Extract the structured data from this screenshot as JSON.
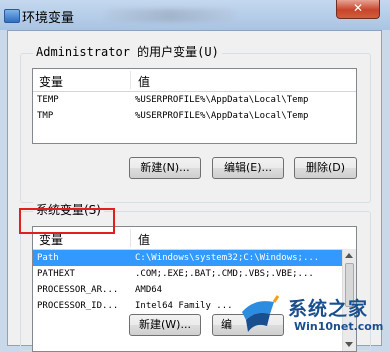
{
  "window": {
    "title": "环境变量",
    "close_label": "✕"
  },
  "user_vars": {
    "title": "Administrator 的用户变量(U)",
    "col_variable": "变量",
    "col_value": "值",
    "rows": [
      {
        "name": "TEMP",
        "value": "%USERPROFILE%\\AppData\\Local\\Temp"
      },
      {
        "name": "TMP",
        "value": "%USERPROFILE%\\AppData\\Local\\Temp"
      }
    ],
    "buttons": {
      "new": "新建(N)...",
      "edit": "编辑(E)...",
      "delete": "删除(D)"
    }
  },
  "system_vars": {
    "title": "系统变量(S)",
    "col_variable": "变量",
    "col_value": "值",
    "rows": [
      {
        "name": "Path",
        "value": "C:\\Windows\\system32;C:\\Windows;...",
        "selected": true
      },
      {
        "name": "PATHEXT",
        "value": ".COM;.EXE;.BAT;.CMD;.VBS;.VBE;...",
        "selected": false
      },
      {
        "name": "PROCESSOR_AR...",
        "value": "AMD64",
        "selected": false
      },
      {
        "name": "PROCESSOR_ID...",
        "value": "Intel64 Family ...",
        "selected": false
      }
    ],
    "buttons": {
      "new": "新建(W)...",
      "edit": "编"
    }
  },
  "watermark": {
    "title": "系统之家",
    "url": "Win10net.com"
  },
  "colors": {
    "selection": "#3399ff",
    "highlight_box": "#e02020",
    "titlebar": "#b7cde8"
  }
}
